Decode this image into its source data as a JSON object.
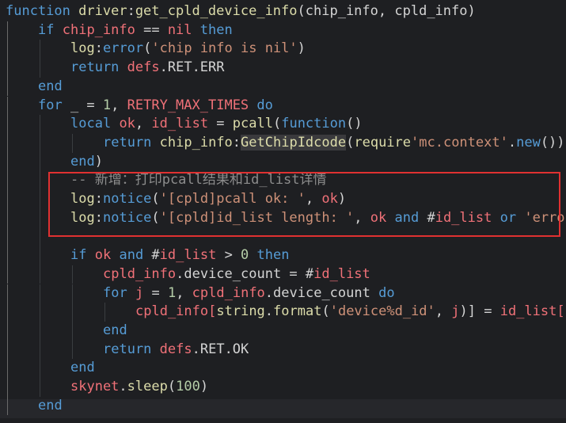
{
  "code": {
    "indent_spaces": 4,
    "lines": [
      {
        "indent": 0,
        "tokens": [
          [
            "function",
            "kw"
          ],
          [
            " ",
            "op"
          ],
          [
            "driver",
            "fn"
          ],
          [
            ":",
            "op"
          ],
          [
            "get_cpld_device_info",
            "fn"
          ],
          [
            "(",
            "op"
          ],
          [
            "chip_info",
            "mod"
          ],
          [
            ", ",
            "op"
          ],
          [
            "cpld_info",
            "mod"
          ],
          [
            ")",
            "op"
          ]
        ]
      },
      {
        "indent": 1,
        "tokens": [
          [
            "if",
            "kw"
          ],
          [
            " ",
            "op"
          ],
          [
            "chip_info",
            "var"
          ],
          [
            " == ",
            "op"
          ],
          [
            "nil",
            "var"
          ],
          [
            " ",
            "op"
          ],
          [
            "then",
            "kw"
          ]
        ]
      },
      {
        "indent": 2,
        "tokens": [
          [
            "log",
            "fn"
          ],
          [
            ":",
            "op"
          ],
          [
            "error",
            "kw"
          ],
          [
            "(",
            "op"
          ],
          [
            "'chip info is nil'",
            "str"
          ],
          [
            ")",
            "op"
          ]
        ]
      },
      {
        "indent": 2,
        "tokens": [
          [
            "return",
            "kw"
          ],
          [
            " ",
            "op"
          ],
          [
            "defs",
            "var"
          ],
          [
            ".RET.ERR",
            "mod"
          ]
        ]
      },
      {
        "indent": 1,
        "tokens": [
          [
            "end",
            "kw"
          ]
        ]
      },
      {
        "indent": 1,
        "tokens": [
          [
            "for",
            "kw"
          ],
          [
            " _ = ",
            "op"
          ],
          [
            "1",
            "num"
          ],
          [
            ", ",
            "op"
          ],
          [
            "RETRY_MAX_TIMES",
            "var"
          ],
          [
            " ",
            "op"
          ],
          [
            "do",
            "kw"
          ]
        ]
      },
      {
        "indent": 2,
        "tokens": [
          [
            "local",
            "kw"
          ],
          [
            " ",
            "op"
          ],
          [
            "ok",
            "var"
          ],
          [
            ", ",
            "op"
          ],
          [
            "id_list",
            "var"
          ],
          [
            " = ",
            "op"
          ],
          [
            "pcall",
            "fn"
          ],
          [
            "(",
            "op"
          ],
          [
            "function",
            "kw"
          ],
          [
            "()",
            "op"
          ]
        ]
      },
      {
        "indent": 3,
        "tokens": [
          [
            "return",
            "kw"
          ],
          [
            " ",
            "op"
          ],
          [
            "chip_info",
            "fn"
          ],
          [
            ":",
            "op"
          ],
          [
            "GetChipIdcode",
            "hlfn"
          ],
          [
            "(",
            "op"
          ],
          [
            "require",
            "fn"
          ],
          [
            "'mc.context'",
            "str"
          ],
          [
            ".",
            "op"
          ],
          [
            "new",
            "kw"
          ],
          [
            "())",
            "op"
          ]
        ]
      },
      {
        "indent": 2,
        "tokens": [
          [
            "end",
            "kw"
          ],
          [
            ")",
            "op"
          ]
        ]
      },
      {
        "indent": 2,
        "tokens": [
          [
            "-- 新增：打印pcall结果和id_list详情",
            "cmt"
          ]
        ]
      },
      {
        "indent": 2,
        "tokens": [
          [
            "log",
            "fn"
          ],
          [
            ":",
            "op"
          ],
          [
            "notice",
            "kw"
          ],
          [
            "(",
            "op"
          ],
          [
            "'[cpld]pcall ok: '",
            "str"
          ],
          [
            ", ",
            "op"
          ],
          [
            "ok",
            "var"
          ],
          [
            ")",
            "op"
          ]
        ]
      },
      {
        "indent": 2,
        "tokens": [
          [
            "log",
            "fn"
          ],
          [
            ":",
            "op"
          ],
          [
            "notice",
            "kw"
          ],
          [
            "(",
            "op"
          ],
          [
            "'[cpld]id_list length: '",
            "str"
          ],
          [
            ", ",
            "op"
          ],
          [
            "ok",
            "var"
          ],
          [
            " ",
            "op"
          ],
          [
            "and",
            "kw"
          ],
          [
            " #",
            "op"
          ],
          [
            "id_list",
            "var"
          ],
          [
            " ",
            "op"
          ],
          [
            "or",
            "kw"
          ],
          [
            " ",
            "op"
          ],
          [
            "'error'",
            "str"
          ],
          [
            ")",
            "op"
          ]
        ]
      },
      {
        "indent": 0,
        "tokens": []
      },
      {
        "indent": 2,
        "tokens": [
          [
            "if",
            "kw"
          ],
          [
            " ",
            "op"
          ],
          [
            "ok",
            "var"
          ],
          [
            " ",
            "op"
          ],
          [
            "and",
            "kw"
          ],
          [
            " #",
            "op"
          ],
          [
            "id_list",
            "var"
          ],
          [
            " > ",
            "op"
          ],
          [
            "0",
            "num"
          ],
          [
            " ",
            "op"
          ],
          [
            "then",
            "kw"
          ]
        ]
      },
      {
        "indent": 3,
        "tokens": [
          [
            "cpld_info",
            "var"
          ],
          [
            ".device_count = #",
            "op"
          ],
          [
            "id_list",
            "var"
          ]
        ]
      },
      {
        "indent": 3,
        "tokens": [
          [
            "for",
            "kw"
          ],
          [
            " ",
            "op"
          ],
          [
            "j",
            "var"
          ],
          [
            " = ",
            "op"
          ],
          [
            "1",
            "num"
          ],
          [
            ", ",
            "op"
          ],
          [
            "cpld_info",
            "var"
          ],
          [
            ".device_count ",
            "op"
          ],
          [
            "do",
            "kw"
          ]
        ]
      },
      {
        "indent": 4,
        "tokens": [
          [
            "cpld_info",
            "var"
          ],
          [
            "[",
            "var"
          ],
          [
            "string",
            "fn"
          ],
          [
            ".",
            "op"
          ],
          [
            "format",
            "fn"
          ],
          [
            "(",
            "op"
          ],
          [
            "'device%d_id'",
            "str"
          ],
          [
            ", ",
            "op"
          ],
          [
            "j",
            "var"
          ],
          [
            ")] = ",
            "op"
          ],
          [
            "id_list",
            "var"
          ],
          [
            "[j]",
            "var"
          ]
        ]
      },
      {
        "indent": 3,
        "tokens": [
          [
            "end",
            "kw"
          ]
        ]
      },
      {
        "indent": 3,
        "tokens": [
          [
            "return",
            "kw"
          ],
          [
            " ",
            "op"
          ],
          [
            "defs",
            "var"
          ],
          [
            ".RET.OK",
            "mod"
          ]
        ]
      },
      {
        "indent": 2,
        "tokens": [
          [
            "end",
            "kw"
          ]
        ]
      },
      {
        "indent": 2,
        "tokens": [
          [
            "skynet",
            "var"
          ],
          [
            ".",
            "op"
          ],
          [
            "sleep",
            "fn"
          ],
          [
            "(",
            "op"
          ],
          [
            "100",
            "num"
          ],
          [
            ")",
            "op"
          ]
        ]
      },
      {
        "indent": 1,
        "tokens": [
          [
            "end",
            "kw"
          ]
        ]
      }
    ]
  }
}
